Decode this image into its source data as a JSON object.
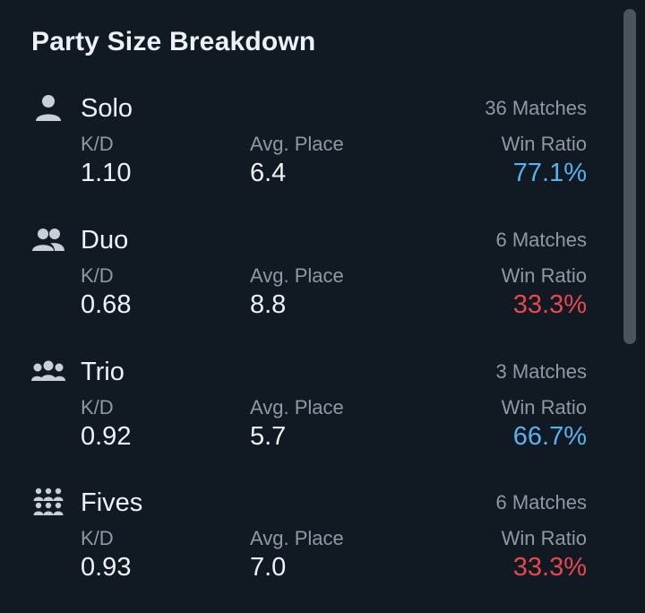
{
  "panel": {
    "title": "Party Size Breakdown"
  },
  "colors": {
    "positive": "#5ab2ec",
    "negative": "#e5484d",
    "muted": "#8e99a5",
    "background": "#111922"
  },
  "labels": {
    "kd": "K/D",
    "avg_place": "Avg. Place",
    "win_ratio": "Win Ratio"
  },
  "rows": [
    {
      "icon": "person-icon",
      "name": "Solo",
      "matches": "36 Matches",
      "kd": "1.10",
      "avg_place": "6.4",
      "win_ratio": "77.1%",
      "win_status": "positive"
    },
    {
      "icon": "two-people-icon",
      "name": "Duo",
      "matches": "6 Matches",
      "kd": "0.68",
      "avg_place": "8.8",
      "win_ratio": "33.3%",
      "win_status": "negative"
    },
    {
      "icon": "three-people-icon",
      "name": "Trio",
      "matches": "3 Matches",
      "kd": "0.92",
      "avg_place": "5.7",
      "win_ratio": "66.7%",
      "win_status": "positive"
    },
    {
      "icon": "group-of-people-icon",
      "name": "Fives",
      "matches": "6 Matches",
      "kd": "0.93",
      "avg_place": "7.0",
      "win_ratio": "33.3%",
      "win_status": "negative"
    }
  ]
}
